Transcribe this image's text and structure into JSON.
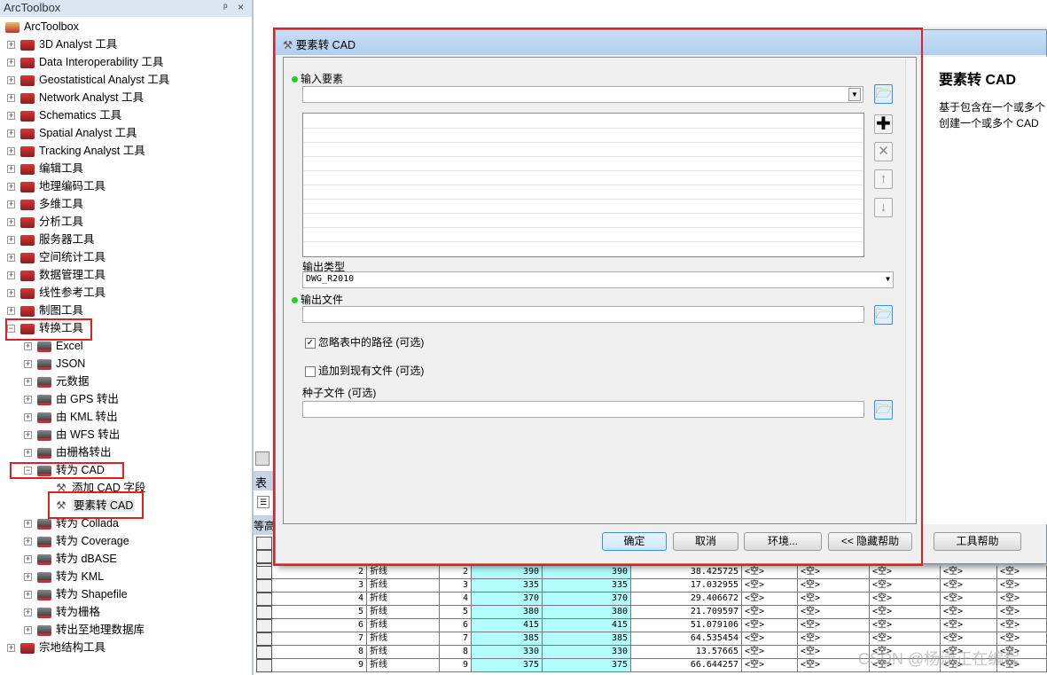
{
  "toolbox": {
    "title": "ArcToolbox",
    "pin": "ᵖ",
    "close": "×",
    "root": "ArcToolbox",
    "items": [
      {
        "label": "3D Analyst 工具",
        "expander": "+",
        "level": 0,
        "icon": "toolbox-icon"
      },
      {
        "label": "Data Interoperability 工具",
        "expander": "+",
        "level": 0,
        "icon": "toolbox-icon"
      },
      {
        "label": "Geostatistical Analyst 工具",
        "expander": "+",
        "level": 0,
        "icon": "toolbox-icon"
      },
      {
        "label": "Network Analyst 工具",
        "expander": "+",
        "level": 0,
        "icon": "toolbox-icon"
      },
      {
        "label": "Schematics 工具",
        "expander": "+",
        "level": 0,
        "icon": "toolbox-icon"
      },
      {
        "label": "Spatial Analyst 工具",
        "expander": "+",
        "level": 0,
        "icon": "toolbox-icon"
      },
      {
        "label": "Tracking Analyst 工具",
        "expander": "+",
        "level": 0,
        "icon": "toolbox-icon"
      },
      {
        "label": "编辑工具",
        "expander": "+",
        "level": 0,
        "icon": "toolbox-icon"
      },
      {
        "label": "地理编码工具",
        "expander": "+",
        "level": 0,
        "icon": "toolbox-icon"
      },
      {
        "label": "多维工具",
        "expander": "+",
        "level": 0,
        "icon": "toolbox-icon"
      },
      {
        "label": "分析工具",
        "expander": "+",
        "level": 0,
        "icon": "toolbox-icon"
      },
      {
        "label": "服务器工具",
        "expander": "+",
        "level": 0,
        "icon": "toolbox-icon"
      },
      {
        "label": "空间统计工具",
        "expander": "+",
        "level": 0,
        "icon": "toolbox-icon"
      },
      {
        "label": "数据管理工具",
        "expander": "+",
        "level": 0,
        "icon": "toolbox-icon"
      },
      {
        "label": "线性参考工具",
        "expander": "+",
        "level": 0,
        "icon": "toolbox-icon"
      },
      {
        "label": "制图工具",
        "expander": "+",
        "level": 0,
        "icon": "toolbox-icon"
      },
      {
        "label": "转换工具",
        "expander": "−",
        "level": 0,
        "icon": "toolbox-icon",
        "highlight": true
      },
      {
        "label": "Excel",
        "expander": "+",
        "level": 1,
        "icon": "toolset-icon"
      },
      {
        "label": "JSON",
        "expander": "+",
        "level": 1,
        "icon": "toolset-icon"
      },
      {
        "label": "元数据",
        "expander": "+",
        "level": 1,
        "icon": "toolset-icon"
      },
      {
        "label": "由 GPS 转出",
        "expander": "+",
        "level": 1,
        "icon": "toolset-icon"
      },
      {
        "label": "由 KML 转出",
        "expander": "+",
        "level": 1,
        "icon": "toolset-icon"
      },
      {
        "label": "由 WFS 转出",
        "expander": "+",
        "level": 1,
        "icon": "toolset-icon"
      },
      {
        "label": "由栅格转出",
        "expander": "+",
        "level": 1,
        "icon": "toolset-icon"
      },
      {
        "label": "转为 CAD",
        "expander": "−",
        "level": 1,
        "icon": "toolset-icon",
        "highlight": true
      },
      {
        "label": "添加 CAD 字段",
        "expander": "",
        "level": 2,
        "icon": "hammer-icon"
      },
      {
        "label": "要素转 CAD",
        "expander": "",
        "level": 2,
        "icon": "hammer-icon",
        "highlight": true,
        "selected": true
      },
      {
        "label": "转为 Collada",
        "expander": "+",
        "level": 1,
        "icon": "toolset-icon"
      },
      {
        "label": "转为 Coverage",
        "expander": "+",
        "level": 1,
        "icon": "toolset-icon"
      },
      {
        "label": "转为 dBASE",
        "expander": "+",
        "level": 1,
        "icon": "toolset-icon"
      },
      {
        "label": "转为 KML",
        "expander": "+",
        "level": 1,
        "icon": "toolset-icon"
      },
      {
        "label": "转为 Shapefile",
        "expander": "+",
        "level": 1,
        "icon": "toolset-icon"
      },
      {
        "label": "转为栅格",
        "expander": "+",
        "level": 1,
        "icon": "toolset-icon"
      },
      {
        "label": "转出至地理数据库",
        "expander": "+",
        "level": 1,
        "icon": "toolset-icon"
      },
      {
        "label": "宗地结构工具",
        "expander": "+",
        "level": 0,
        "icon": "toolbox-icon"
      }
    ]
  },
  "side_strip": {
    "table_label": "表",
    "layer_label": "等高"
  },
  "table": {
    "rows": [
      [
        "2",
        "折线",
        "2",
        "390",
        "390",
        "38.425725",
        "<空>",
        "<空>",
        "<空>",
        "<空>",
        "<空>"
      ],
      [
        "3",
        "折线",
        "3",
        "335",
        "335",
        "17.032955",
        "<空>",
        "<空>",
        "<空>",
        "<空>",
        "<空>"
      ],
      [
        "4",
        "折线",
        "4",
        "370",
        "370",
        "29.406672",
        "<空>",
        "<空>",
        "<空>",
        "<空>",
        "<空>"
      ],
      [
        "5",
        "折线",
        "5",
        "380",
        "380",
        "21.709597",
        "<空>",
        "<空>",
        "<空>",
        "<空>",
        "<空>"
      ],
      [
        "6",
        "折线",
        "6",
        "415",
        "415",
        "51.079106",
        "<空>",
        "<空>",
        "<空>",
        "<空>",
        "<空>"
      ],
      [
        "7",
        "折线",
        "7",
        "385",
        "385",
        "64.535454",
        "<空>",
        "<空>",
        "<空>",
        "<空>",
        "<空>"
      ],
      [
        "8",
        "折线",
        "8",
        "330",
        "330",
        "13.57665",
        "<空>",
        "<空>",
        "<空>",
        "<空>",
        "<空>"
      ],
      [
        "9",
        "折线",
        "9",
        "375",
        "375",
        "66.644257",
        "<空>",
        "<空>",
        "<空>",
        "<空>",
        "<空>"
      ]
    ]
  },
  "dialog": {
    "title": "要素转 CAD",
    "input_features_label": "输入要素",
    "input_features_value": "",
    "output_type_label": "输出类型",
    "output_type_value": "DWG_R2010",
    "output_file_label": "输出文件",
    "output_file_value": "",
    "ignore_paths_label": "忽略表中的路径 (可选)",
    "ignore_paths_checked": true,
    "append_label": "追加到现有文件 (可选)",
    "append_checked": false,
    "seed_file_label": "种子文件 (可选)",
    "seed_file_value": "",
    "buttons": {
      "ok": "确定",
      "cancel": "取消",
      "env": "环境...",
      "hide_help": "<< 隐藏帮助",
      "tool_help": "工具帮助"
    },
    "help": {
      "title": "要素转  CAD",
      "line1": "基于包含在一个或多个",
      "line2": "创建一个或多个  CAD"
    }
  },
  "accent": {
    "highlight": "#e02020",
    "required_dot": "#1dd31d",
    "cyan_cell": "#b2fdfd"
  },
  "watermark": "CSDN @杨潇正在编程"
}
